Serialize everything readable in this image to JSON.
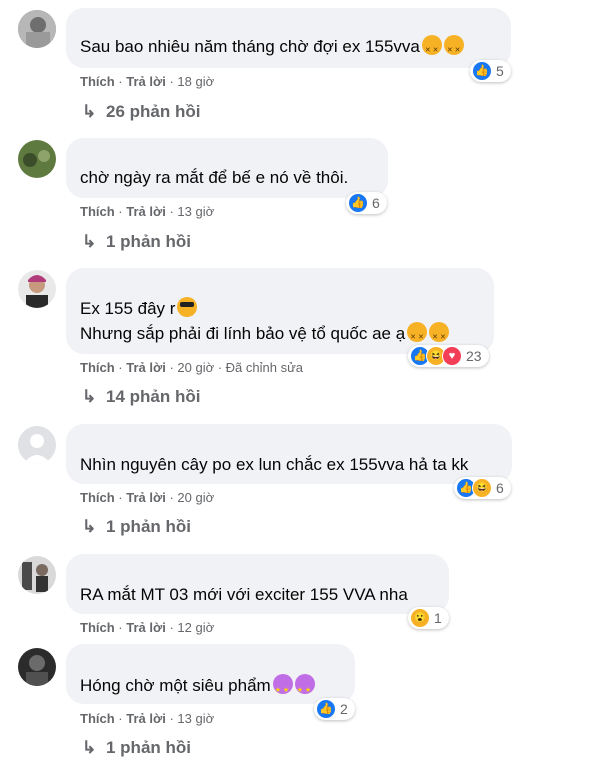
{
  "comments": [
    {
      "author": "",
      "text_lines": [
        "Sau bao nhiêu năm tháng chờ đợi ex 155vva"
      ],
      "like": "Thích",
      "reply": "Trả lời",
      "time": "18 giờ",
      "edited": "",
      "reaction_count": "5",
      "reactions": [
        "like"
      ],
      "replies": "26 phản hồi"
    },
    {
      "author": "",
      "text_lines": [
        "chờ ngày ra mắt để bế e nó về thôi."
      ],
      "like": "Thích",
      "reply": "Trả lời",
      "time": "13 giờ",
      "edited": "",
      "reaction_count": "6",
      "reactions": [
        "like"
      ],
      "replies": "1 phản hồi"
    },
    {
      "author": "",
      "text_lines": [
        "Ex 155 đây r",
        "Nhưng sắp phải đi lính bảo vệ tổ quốc ae ạ"
      ],
      "like": "Thích",
      "reply": "Trả lời",
      "time": "20 giờ",
      "edited": "Đã chỉnh sửa",
      "reaction_count": "23",
      "reactions": [
        "like",
        "haha",
        "heart"
      ],
      "replies": "14 phản hồi"
    },
    {
      "author": "",
      "text_lines": [
        "Nhìn nguyên cây po ex lun chắc ex 155vva hả ta kk"
      ],
      "like": "Thích",
      "reply": "Trả lời",
      "time": "20 giờ",
      "edited": "",
      "reaction_count": "6",
      "reactions": [
        "like",
        "haha"
      ],
      "replies": "1 phản hồi"
    },
    {
      "author": "",
      "text_lines": [
        "RA mắt MT 03 mới với exciter 155 VVA nha"
      ],
      "like": "Thích",
      "reply": "Trả lời",
      "time": "12 giờ",
      "edited": "",
      "reaction_count": "1",
      "reactions": [
        "wow"
      ],
      "replies": ""
    },
    {
      "author": "",
      "text_lines": [
        "Hóng chờ một siêu phẩm"
      ],
      "like": "Thích",
      "reply": "Trả lời",
      "time": "13 giờ",
      "edited": "",
      "reaction_count": "2",
      "reactions": [
        "like"
      ],
      "replies": "1 phản hồi"
    }
  ],
  "colors": {
    "bubble": "#f0f2f5",
    "meta": "#65676b",
    "like": "#1877f2",
    "haha": "#f7b125",
    "heart": "#f33e58"
  }
}
